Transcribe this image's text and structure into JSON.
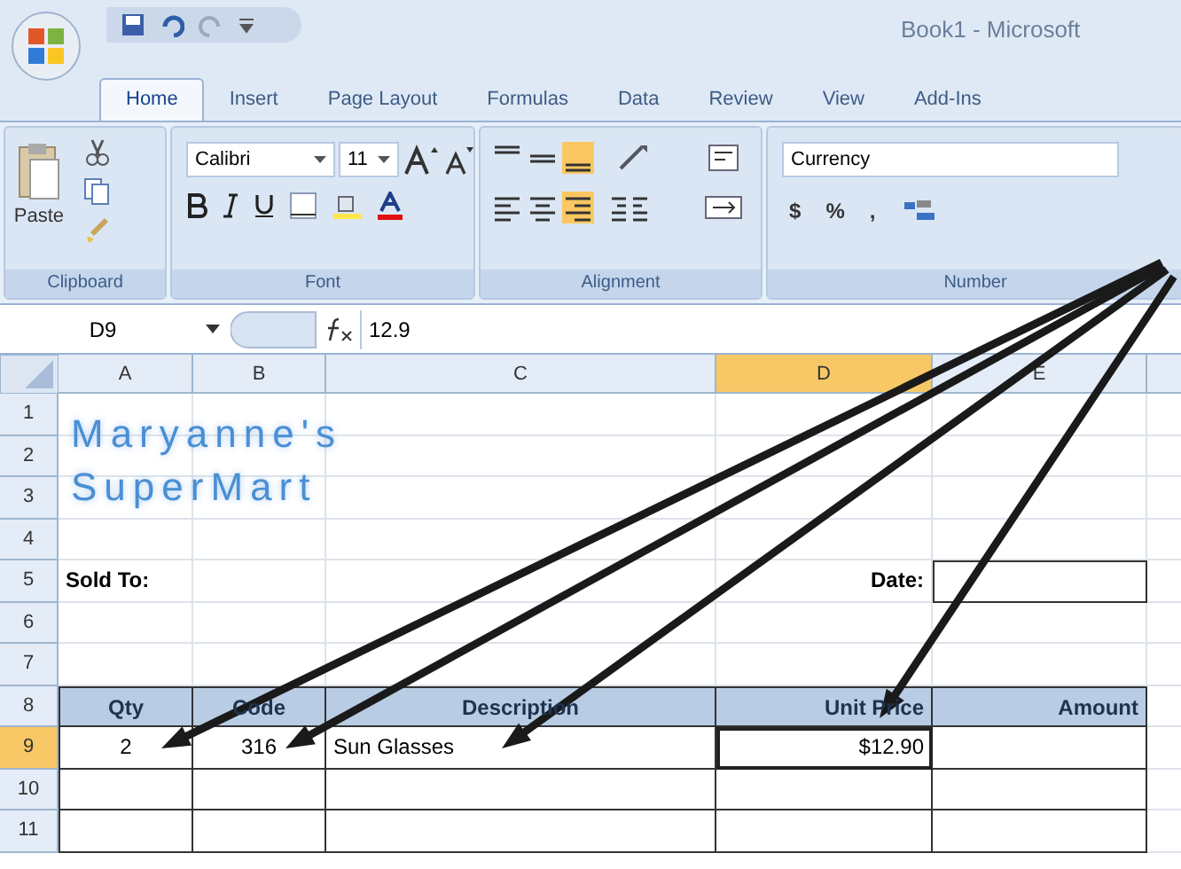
{
  "title_bar": {
    "title": "Book1 - Microsoft"
  },
  "tabs": [
    {
      "label": "Home",
      "selected": true
    },
    {
      "label": "Insert",
      "selected": false
    },
    {
      "label": "Page Layout",
      "selected": false
    },
    {
      "label": "Formulas",
      "selected": false
    },
    {
      "label": "Data",
      "selected": false
    },
    {
      "label": "Review",
      "selected": false
    },
    {
      "label": "View",
      "selected": false
    },
    {
      "label": "Add-Ins",
      "selected": false
    }
  ],
  "ribbon": {
    "clipboard": {
      "paste": "Paste",
      "label": "Clipboard"
    },
    "font": {
      "name": "Calibri",
      "size": "11",
      "label": "Font"
    },
    "alignment": {
      "label": "Alignment",
      "buttons": [
        {
          "kind": "top",
          "on": false
        },
        {
          "kind": "middle",
          "on": false
        },
        {
          "kind": "bottom",
          "on": true
        },
        {
          "kind": "left",
          "on": false
        },
        {
          "kind": "center",
          "on": false
        },
        {
          "kind": "right",
          "on": true
        }
      ]
    },
    "number": {
      "format": "Currency",
      "currency": "$",
      "percent": "%",
      "comma": ",",
      "label": "Number"
    }
  },
  "formula_bar": {
    "cell": "D9",
    "formula": "12.9"
  },
  "sheet": {
    "columns": [
      {
        "label": "A",
        "selected": false
      },
      {
        "label": "B",
        "selected": false
      },
      {
        "label": "C",
        "selected": false
      },
      {
        "label": "D",
        "selected": true
      },
      {
        "label": "E",
        "selected": false
      }
    ],
    "title_lines": [
      "Maryanne's",
      "SuperMart"
    ],
    "rows": [
      {
        "label": "1",
        "selected": false,
        "kind": "blank"
      },
      {
        "label": "2",
        "selected": false,
        "kind": "blank"
      },
      {
        "label": "3",
        "selected": false,
        "kind": "blank"
      },
      {
        "label": "4",
        "selected": false,
        "kind": "blank"
      },
      {
        "label": "5",
        "selected": false,
        "kind": "form",
        "a": {
          "text": "Sold To:"
        },
        "d": {
          "text": "Date:"
        }
      },
      {
        "label": "6",
        "selected": false,
        "kind": "blank"
      },
      {
        "label": "7",
        "selected": false,
        "kind": "blank"
      },
      {
        "label": "8",
        "selected": false,
        "kind": "table_header",
        "a": {
          "text": "Qty"
        },
        "b": {
          "text": "Code"
        },
        "c": {
          "text": "Description"
        },
        "d": {
          "text": "Unit Price"
        },
        "e": {
          "text": "Amount"
        }
      },
      {
        "label": "9",
        "selected": true,
        "kind": "table_row",
        "a": {
          "text": "2"
        },
        "b": {
          "text": "316"
        },
        "c": {
          "text": "Sun Glasses"
        },
        "d": {
          "text": "$12.90",
          "selected": true
        }
      },
      {
        "label": "10",
        "selected": false,
        "kind": "table_row"
      },
      {
        "label": "11",
        "selected": false,
        "kind": "table_row"
      }
    ]
  }
}
